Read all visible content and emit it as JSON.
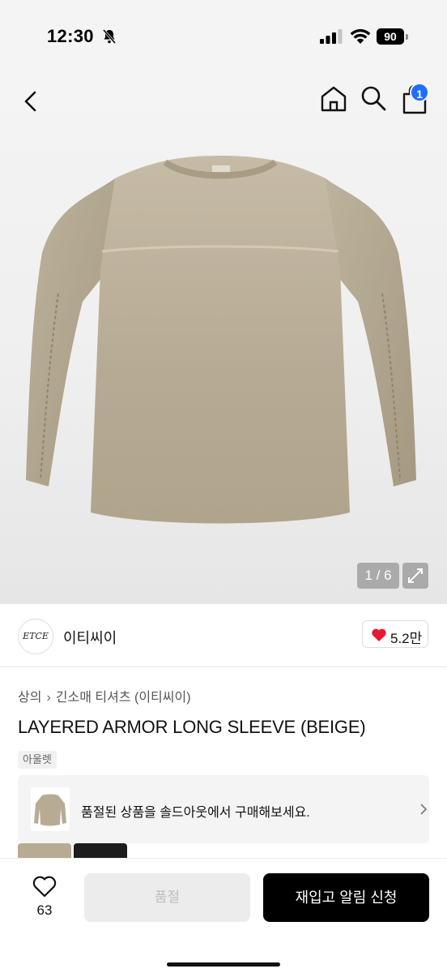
{
  "status_bar": {
    "time": "12:30",
    "battery": "90"
  },
  "header": {
    "cart_badge": "1"
  },
  "gallery": {
    "counter": "1 / 6"
  },
  "brand": {
    "logo_text": "ETCE",
    "name": "이티씨이",
    "likes": "5.2만"
  },
  "breadcrumb": {
    "category": "상의",
    "subcategory": "긴소매 티셔츠 (이티씨이)"
  },
  "product": {
    "title": "LAYERED ARMOR LONG SLEEVE (BEIGE)",
    "tag": "아울렛"
  },
  "soldout_banner": {
    "text": "품절된 상품을 솔드아웃에서 구매해보세요."
  },
  "bottom_bar": {
    "wish_count": "63",
    "soldout_label": "품절",
    "restock_label": "재입고 알림 신청"
  },
  "colors": {
    "accent": "#1f6dff",
    "heart": "#e8192c",
    "shirt": "#b8ab94"
  }
}
